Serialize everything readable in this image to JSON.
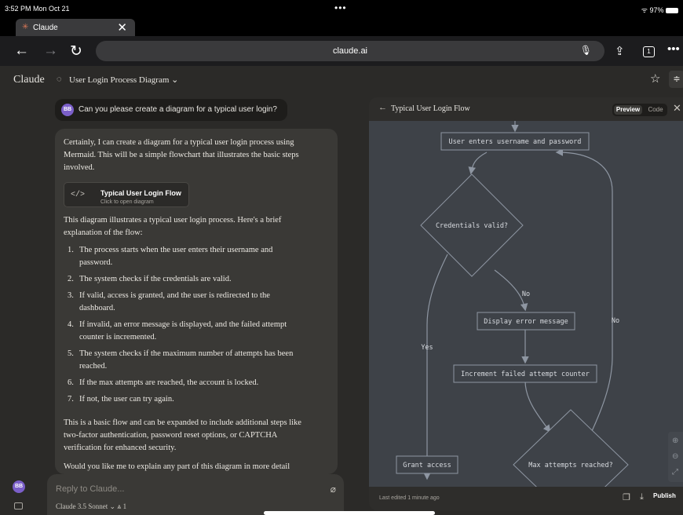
{
  "status": {
    "time": "3:52 PM  Mon Oct 21",
    "dots": "•••",
    "battery": "97%"
  },
  "browser": {
    "tab_title": "Claude",
    "tab_close": "✕",
    "new_tab": "+",
    "url": "claude.ai",
    "tab_count": "1",
    "back": "←",
    "forward": "→",
    "reload": "↻",
    "more": "•••"
  },
  "app": {
    "brand": "Claude",
    "chat_title": "User Login Process Diagram ⌄"
  },
  "user_message": {
    "avatar": "BB",
    "text": "Can you please create a diagram for a typical user login?"
  },
  "response": {
    "intro": "Certainly, I can create a diagram for a typical user login process using Mermaid. This will be a simple flowchart that illustrates the basic steps involved.",
    "artifact_icon": "</>",
    "artifact_title": "Typical User Login Flow",
    "artifact_sub": "Click to open diagram",
    "explain": "This diagram illustrates a typical user login process. Here's a brief explanation of the flow:",
    "steps": [
      "The process starts when the user enters their username and password.",
      "The system checks if the credentials are valid.",
      "If valid, access is granted, and the user is redirected to the dashboard.",
      "If invalid, an error message is displayed, and the failed attempt counter is incremented.",
      "The system checks if the maximum number of attempts has been reached.",
      "If the max attempts are reached, the account is locked.",
      "If not, the user can try again."
    ],
    "outro": "This is a basic flow and can be expanded to include additional steps like two-factor authentication, password reset options, or CAPTCHA verification for enhanced security.",
    "question": "Would you like me to explain any part of this diagram in more detail"
  },
  "reply": {
    "placeholder": "Reply to Claude...",
    "model": "Claude 3.5 Sonnet ⌄   ⩓ 1"
  },
  "sidebar_avatar": "BB",
  "panel": {
    "back": "←",
    "title": "Typical User Login Flow",
    "preview": "Preview",
    "code": "Code",
    "close": "✕",
    "edited": "Last edited 1 minute ago",
    "publish": "Publish"
  },
  "diagram": {
    "nodes": {
      "enter": "User enters username and password",
      "valid": "Credentials valid?",
      "error": "Display error message",
      "increment": "Increment failed attempt counter",
      "grant": "Grant access",
      "max": "Max attempts reached?"
    },
    "edges": {
      "no1": "No",
      "no2": "No",
      "yes": "Yes"
    }
  }
}
